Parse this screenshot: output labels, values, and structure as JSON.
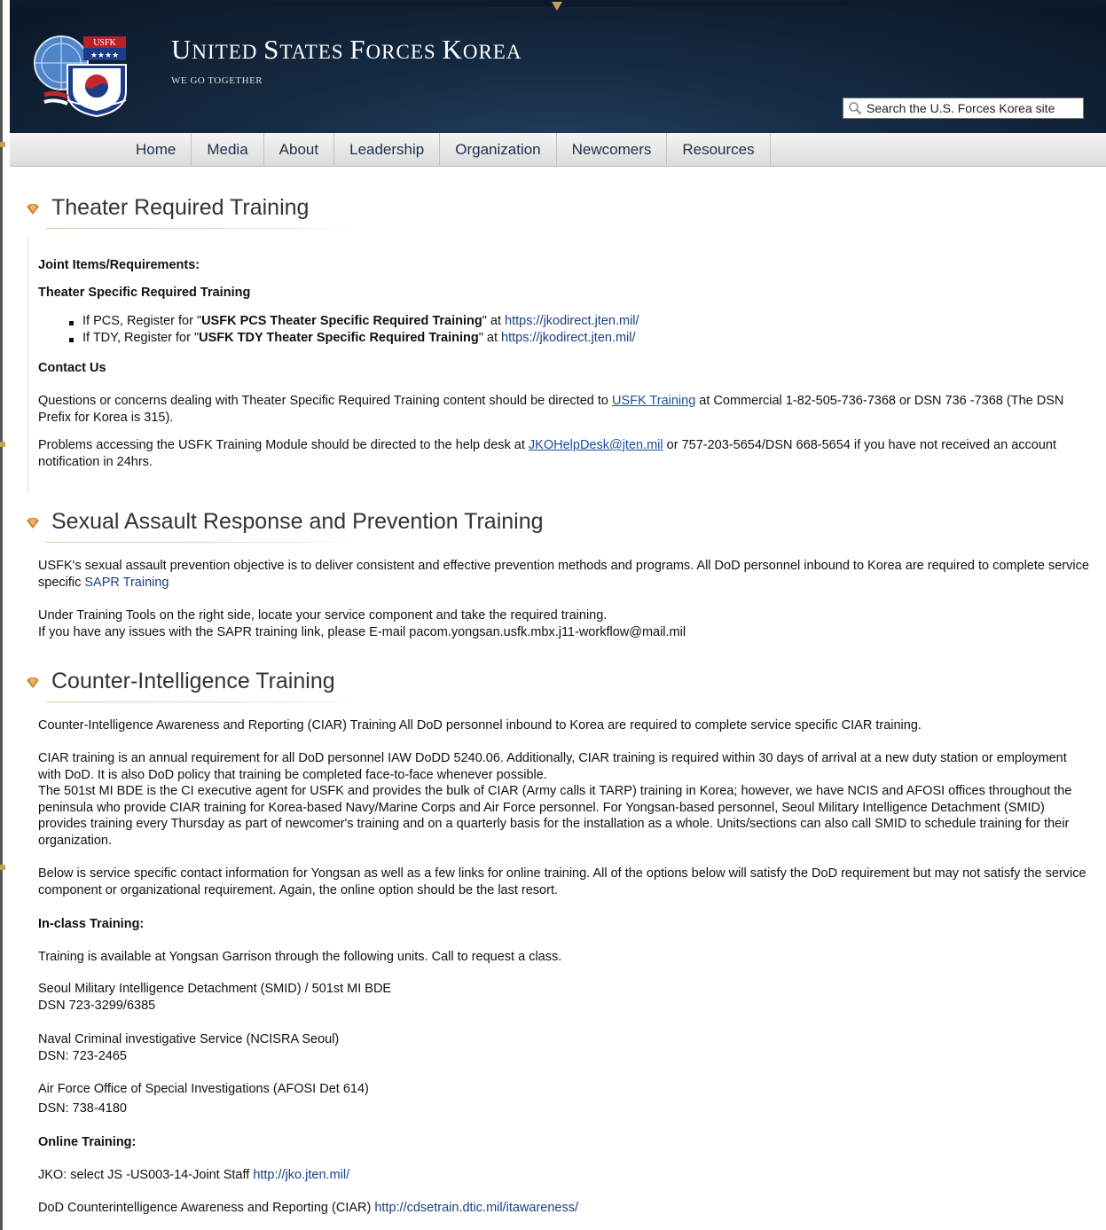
{
  "header": {
    "emblem_badge": "USFK",
    "site_title_first": "U",
    "site_title_rest": "NITED ",
    "site_title_s": "S",
    "site_title_rest2": "TATES ",
    "site_title_f": "F",
    "site_title_rest3": "ORCES ",
    "site_title_k": "K",
    "site_title_rest4": "OREA",
    "motto": "WE GO TOGETHER",
    "search_placeholder": "Search the U.S. Forces Korea site",
    "search_icon": "search-icon"
  },
  "nav": {
    "items": [
      "Home",
      "Media",
      "About",
      "Leadership",
      "Organization",
      "Newcomers",
      "Resources"
    ]
  },
  "sections": {
    "theater": {
      "title": "Theater Required Training",
      "joint_heading": "Joint Items/Requirements:",
      "specific_heading": "Theater Specific Required Training",
      "pcs_prefix": "If PCS, Register for \"",
      "pcs_bold": "USFK PCS Theater Specific Required Training",
      "pcs_mid": "\" at ",
      "pcs_link": "https://jkodirect.jten.mil/",
      "tdy_prefix": "If TDY, Register for \"",
      "tdy_bold": "USFK TDY Theater Specific Required Training",
      "tdy_mid": "\" at ",
      "tdy_link": "https://jkodirect.jten.mil/",
      "contact_heading": "Contact Us",
      "contact_p1_a": "Questions or concerns dealing with Theater Specific Required Training content should be directed to ",
      "contact_p1_link": "USFK Training",
      "contact_p1_b": " at Commercial 1-82-505-736-7368 or DSN 736 -7368 (The DSN Prefix for Korea is 315).",
      "contact_p2_a": "Problems accessing the USFK Training Module should be directed to the help desk at ",
      "contact_p2_link": "JKOHelpDesk@jten.mil",
      "contact_p2_b": " or 757-203-5654/DSN 668-5654 if you have not received an account notification in 24hrs."
    },
    "sapr": {
      "title": "Sexual Assault Response and Prevention Training",
      "p1_a": "USFK's sexual assault prevention objective is to deliver consistent and effective prevention methods and programs.  All DoD personnel inbound to Korea are required to complete service specific ",
      "p1_link": "SAPR Training",
      "p2_line1": "Under Training Tools on the right side, locate your service component and take the required training.",
      "p2_line2": "If you have any issues with the SAPR training link, please E-mail pacom.yongsan.usfk.mbx.j11-workflow@mail.mil"
    },
    "ci": {
      "title": "Counter-Intelligence Training",
      "p1": "Counter-Intelligence Awareness and Reporting (CIAR) Training All DoD personnel inbound to Korea are required to complete service specific CIAR training.",
      "p2": "CIAR training is an annual requirement for all DoD personnel IAW DoDD 5240.06. Additionally, CIAR training is required within 30 days of arrival at a new duty station or employment with DoD. It is also DoD policy that training be completed face-to-face whenever possible.",
      "p3": "The 501st MI BDE is the CI executive agent for USFK and provides the bulk of CIAR (Army calls it TARP) training in Korea; however, we have NCIS and AFOSI offices throughout the peninsula who provide CIAR training for Korea-based Navy/Marine Corps and Air Force personnel. For Yongsan-based personnel, Seoul Military Intelligence Detachment (SMID) provides training every Thursday as part of newcomer's training and on a quarterly basis for the installation as a whole. Units/sections can also call SMID to schedule training for their organization.",
      "p4": "Below is service specific contact information for Yongsan as well as a few links for online training.  All of the options below will satisfy the DoD requirement but may not satisfy the service component or organizational requirement. Again, the online option should be the last resort.",
      "inclass_heading": "In-class Training:",
      "inclass_intro": "Training is available at Yongsan Garrison through the following units. Call to request a class.",
      "smid_name": "Seoul Military Intelligence Detachment (SMID) / 501st MI BDE",
      "smid_phone": "DSN 723-3299/6385",
      "ncis_name": "Naval Criminal investigative Service (NCISRA Seoul)",
      "ncis_phone": "DSN: 723-2465",
      "afosi_name": "Air Force Office of Special Investigations (AFOSI Det 614)",
      "afosi_phone": "DSN: 738-4180",
      "online_heading": "Online Training:",
      "jko_text": "JKO: select JS -US003-14-Joint Staff ",
      "jko_link": "http://jko.jten.mil/",
      "dod_text": "DoD Counterintelligence Awareness and Reporting (CIAR) ",
      "dod_link": "http://cdsetrain.dtic.mil/itawareness/"
    }
  },
  "colors": {
    "header_bg": "#152a42",
    "nav_text": "#1d2f4a",
    "link": "#1a4fa0",
    "bullet_gold": "#c7892a"
  }
}
